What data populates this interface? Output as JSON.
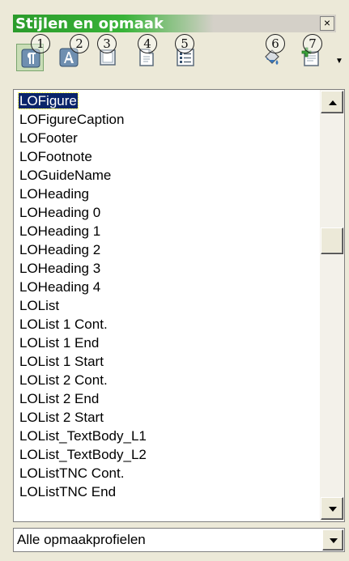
{
  "window": {
    "title": "Stijlen en opmaak",
    "close_symbol": "×"
  },
  "toolbar": {
    "buttons": [
      {
        "number": "1",
        "icon": "paragraph-styles-icon"
      },
      {
        "number": "2",
        "icon": "character-styles-icon"
      },
      {
        "number": "3",
        "icon": "frame-styles-icon"
      },
      {
        "number": "4",
        "icon": "page-styles-icon"
      },
      {
        "number": "5",
        "icon": "list-styles-icon"
      },
      {
        "number": "6",
        "icon": "fill-format-icon"
      },
      {
        "number": "7",
        "icon": "new-style-icon"
      }
    ]
  },
  "styles_list": {
    "selected": "LOFigure",
    "items": [
      "LOFigure",
      "LOFigureCaption",
      "LOFooter",
      "LOFootnote",
      "LOGuideName",
      "LOHeading",
      "LOHeading 0",
      "LOHeading 1",
      "LOHeading 2",
      "LOHeading 3",
      "LOHeading 4",
      "LOList",
      "LOList 1 Cont.",
      "LOList 1 End",
      "LOList 1 Start",
      "LOList 2 Cont.",
      "LOList 2 End",
      "LOList 2 Start",
      "LOList_TextBody_L1",
      "LOList_TextBody_L2",
      "LOListTNC Cont.",
      "LOListTNC End"
    ]
  },
  "filter": {
    "value": "Alle opmaakprofielen"
  },
  "colors": {
    "title_green": "#2b9b2b",
    "selection": "#0a246a",
    "panel": "#ece9d8"
  }
}
